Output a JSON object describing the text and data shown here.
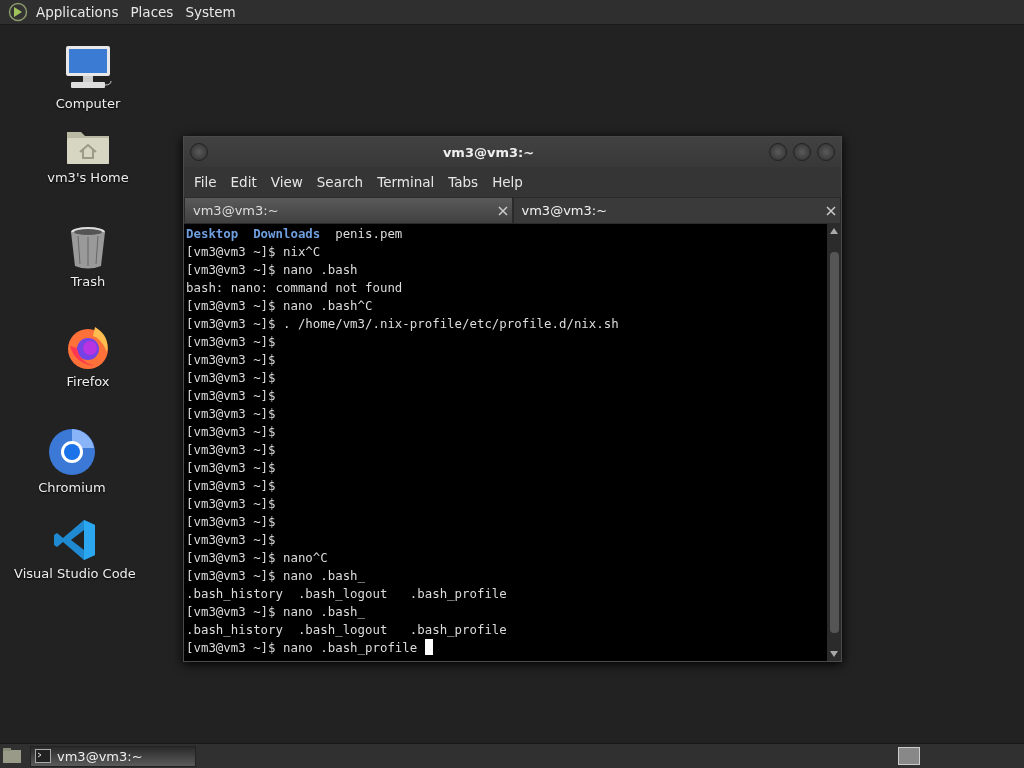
{
  "top_panel": {
    "menus": [
      "Applications",
      "Places",
      "System"
    ]
  },
  "desktop_icons": [
    {
      "label": "Computer",
      "kind": "computer"
    },
    {
      "label": "vm3's Home",
      "kind": "home"
    },
    {
      "label": "Trash",
      "kind": "trash"
    },
    {
      "label": "Firefox",
      "kind": "firefox"
    },
    {
      "label": "Chromium",
      "kind": "chromium"
    },
    {
      "label": "Visual Studio Code",
      "kind": "vscode"
    }
  ],
  "window": {
    "title": "vm3@vm3:~",
    "menu": [
      "File",
      "Edit",
      "View",
      "Search",
      "Terminal",
      "Tabs",
      "Help"
    ],
    "tabs": [
      {
        "label": "vm3@vm3:~",
        "selected": false
      },
      {
        "label": "vm3@vm3:~",
        "selected": true
      }
    ],
    "lines": [
      {
        "kind": "listing",
        "items": [
          {
            "name": "Desktop",
            "kind": "dir"
          },
          {
            "name": "Downloads",
            "kind": "dir"
          },
          {
            "name": "penis.pem",
            "kind": "file"
          }
        ]
      },
      {
        "kind": "text",
        "text": "[vm3@vm3 ~]$ nix^C"
      },
      {
        "kind": "text",
        "text": "[vm3@vm3 ~]$ nano .bash"
      },
      {
        "kind": "text",
        "text": "bash: nano: command not found"
      },
      {
        "kind": "text",
        "text": "[vm3@vm3 ~]$ nano .bash^C"
      },
      {
        "kind": "text",
        "text": "[vm3@vm3 ~]$ . /home/vm3/.nix-profile/etc/profile.d/nix.sh"
      },
      {
        "kind": "text",
        "text": "[vm3@vm3 ~]$"
      },
      {
        "kind": "text",
        "text": "[vm3@vm3 ~]$"
      },
      {
        "kind": "text",
        "text": "[vm3@vm3 ~]$"
      },
      {
        "kind": "text",
        "text": "[vm3@vm3 ~]$"
      },
      {
        "kind": "text",
        "text": "[vm3@vm3 ~]$"
      },
      {
        "kind": "text",
        "text": "[vm3@vm3 ~]$"
      },
      {
        "kind": "text",
        "text": "[vm3@vm3 ~]$"
      },
      {
        "kind": "text",
        "text": "[vm3@vm3 ~]$"
      },
      {
        "kind": "text",
        "text": "[vm3@vm3 ~]$"
      },
      {
        "kind": "text",
        "text": "[vm3@vm3 ~]$"
      },
      {
        "kind": "text",
        "text": "[vm3@vm3 ~]$"
      },
      {
        "kind": "text",
        "text": "[vm3@vm3 ~]$"
      },
      {
        "kind": "text",
        "text": "[vm3@vm3 ~]$ nano^C"
      },
      {
        "kind": "text",
        "text": "[vm3@vm3 ~]$ nano .bash_"
      },
      {
        "kind": "text",
        "text": ".bash_history  .bash_logout   .bash_profile"
      },
      {
        "kind": "text",
        "text": "[vm3@vm3 ~]$ nano .bash_"
      },
      {
        "kind": "text",
        "text": ".bash_history  .bash_logout   .bash_profile"
      },
      {
        "kind": "prompt",
        "text": "[vm3@vm3 ~]$ nano .bash_profile "
      }
    ]
  },
  "taskbar": {
    "tasks": [
      {
        "label": "vm3@vm3:~",
        "selected": true
      }
    ]
  }
}
